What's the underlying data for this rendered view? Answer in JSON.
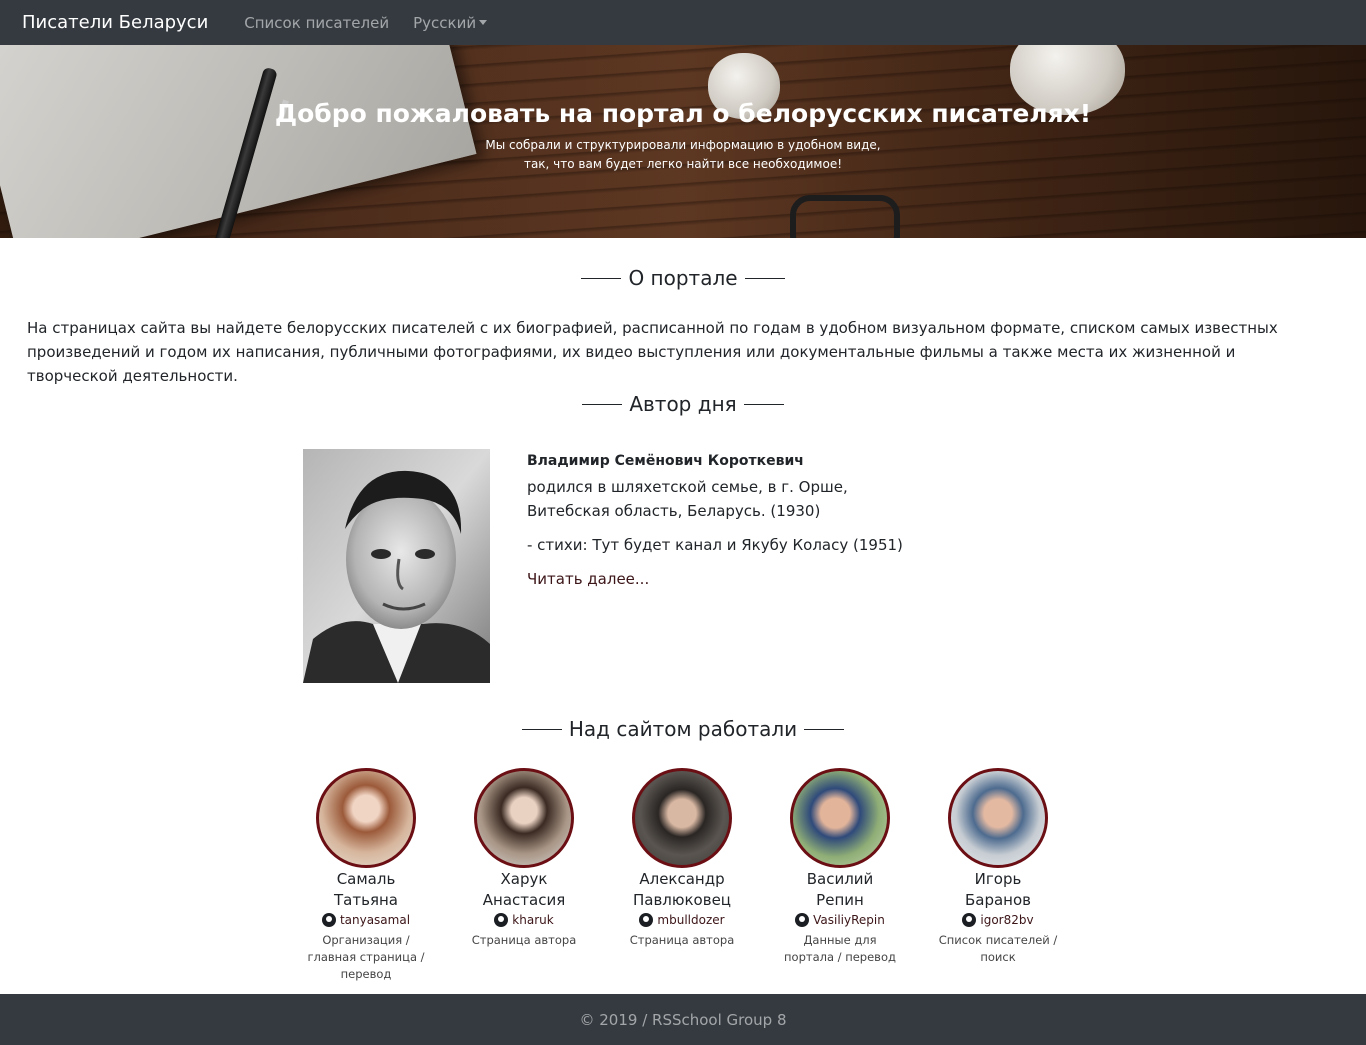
{
  "navbar": {
    "brand": "Писатели Беларуси",
    "links": [
      "Список писателей"
    ],
    "language": "Русский"
  },
  "hero": {
    "title": "Добро пожаловать на портал о белорусских писателях!",
    "subtitle_line1": "Мы собрали и структурировали информацию в удобном виде,",
    "subtitle_line2": "так, что вам будет легко найти все необходимое!"
  },
  "about": {
    "heading": "О портале",
    "text": "На страницах сайта вы найдете белорусских писателей с их биографией, расписанной по годам в удобном визуальном формате, списком самых известных произведений и годом их написания, публичными фотографиями, их видео выступления или документальные фильмы а также места их жизненной и творческой деятельности."
  },
  "author_of_day": {
    "heading": "Автор дня",
    "name": "Владимир Семёнович Короткевич",
    "birth_line1": "родился в шляхетской семье, в г. Орше,",
    "birth_line2": "Витебская область, Беларусь. (1930)",
    "works": "- стихи: Тут будет канал и Якубу Коласу (1951)",
    "read_more": "Читать далее..."
  },
  "team": {
    "heading": "Над сайтом работали",
    "members": [
      {
        "first": "Самаль",
        "last": "Татьяна",
        "github": "tanyasamal",
        "role": "Организация / главная страница / перевод",
        "bg": "#c9a58a"
      },
      {
        "first": "Харук",
        "last": "Анастасия",
        "github": "kharuk",
        "role": "Страница автора",
        "bg": "#b9a79a"
      },
      {
        "first": "Александр",
        "last": "Павлюковец",
        "github": "mbulldozer",
        "role": "Страница автора",
        "bg": "#4c4a47"
      },
      {
        "first": "Василий",
        "last": "Репин",
        "github": "VasiliyRepin",
        "role": "Данные для портала / перевод",
        "bg": "#7f9a6d"
      },
      {
        "first": "Игорь",
        "last": "Баранов",
        "github": "igor82bv",
        "role": "Список писателей / поиск",
        "bg": "#b7bcc2"
      }
    ]
  },
  "footer": {
    "text": "© 2019 / RSSchool Group 8"
  },
  "colors": {
    "navbar_bg": "#343a40",
    "accent_border": "#6b0f14",
    "link": "#3c1518"
  }
}
